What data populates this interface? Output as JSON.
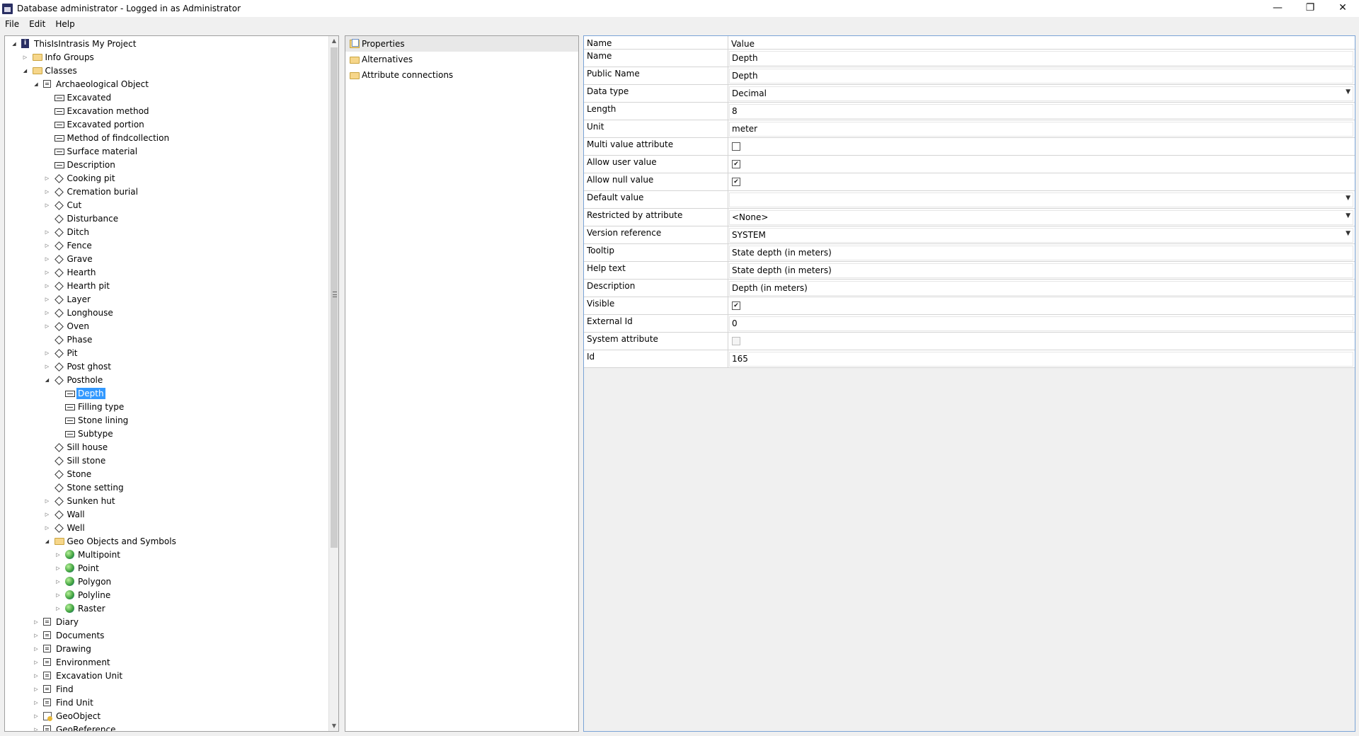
{
  "window": {
    "title": "Database administrator - Logged in as Administrator",
    "controls": {
      "minimize": "—",
      "maximize": "❐",
      "close": "✕"
    }
  },
  "menu": [
    "File",
    "Edit",
    "Help"
  ],
  "tree": [
    {
      "label": "ThisIsIntrasis My Project",
      "depth": 0,
      "icon": "info",
      "expander": "open"
    },
    {
      "label": "Info Groups",
      "depth": 1,
      "icon": "folder",
      "expander": "closed"
    },
    {
      "label": "Classes",
      "depth": 1,
      "icon": "folder",
      "expander": "open"
    },
    {
      "label": "Archaeological Object",
      "depth": 2,
      "icon": "class",
      "expander": "open"
    },
    {
      "label": "Excavated",
      "depth": 3,
      "icon": "attribute",
      "expander": "none"
    },
    {
      "label": "Excavation method",
      "depth": 3,
      "icon": "attribute",
      "expander": "none"
    },
    {
      "label": "Excavated portion",
      "depth": 3,
      "icon": "attribute",
      "expander": "none"
    },
    {
      "label": "Method of findcollection",
      "depth": 3,
      "icon": "attribute",
      "expander": "none"
    },
    {
      "label": "Surface material",
      "depth": 3,
      "icon": "attribute",
      "expander": "none"
    },
    {
      "label": "Description",
      "depth": 3,
      "icon": "attribute",
      "expander": "none"
    },
    {
      "label": "Cooking pit",
      "depth": 3,
      "icon": "subclass",
      "expander": "closed"
    },
    {
      "label": "Cremation burial",
      "depth": 3,
      "icon": "subclass",
      "expander": "closed"
    },
    {
      "label": "Cut",
      "depth": 3,
      "icon": "subclass",
      "expander": "closed"
    },
    {
      "label": "Disturbance",
      "depth": 3,
      "icon": "subclass",
      "expander": "none"
    },
    {
      "label": "Ditch",
      "depth": 3,
      "icon": "subclass",
      "expander": "closed"
    },
    {
      "label": "Fence",
      "depth": 3,
      "icon": "subclass",
      "expander": "closed"
    },
    {
      "label": "Grave",
      "depth": 3,
      "icon": "subclass",
      "expander": "closed"
    },
    {
      "label": "Hearth",
      "depth": 3,
      "icon": "subclass",
      "expander": "closed"
    },
    {
      "label": "Hearth pit",
      "depth": 3,
      "icon": "subclass",
      "expander": "closed"
    },
    {
      "label": "Layer",
      "depth": 3,
      "icon": "subclass",
      "expander": "closed"
    },
    {
      "label": "Longhouse",
      "depth": 3,
      "icon": "subclass",
      "expander": "closed"
    },
    {
      "label": "Oven",
      "depth": 3,
      "icon": "subclass",
      "expander": "closed"
    },
    {
      "label": "Phase",
      "depth": 3,
      "icon": "subclass",
      "expander": "none"
    },
    {
      "label": "Pit",
      "depth": 3,
      "icon": "subclass",
      "expander": "closed"
    },
    {
      "label": "Post ghost",
      "depth": 3,
      "icon": "subclass",
      "expander": "closed"
    },
    {
      "label": "Posthole",
      "depth": 3,
      "icon": "subclass",
      "expander": "open"
    },
    {
      "label": "Depth",
      "depth": 4,
      "icon": "attribute",
      "expander": "none",
      "selected": true
    },
    {
      "label": "Filling type",
      "depth": 4,
      "icon": "attribute",
      "expander": "none"
    },
    {
      "label": "Stone lining",
      "depth": 4,
      "icon": "attribute",
      "expander": "none"
    },
    {
      "label": "Subtype",
      "depth": 4,
      "icon": "attribute",
      "expander": "none"
    },
    {
      "label": "Sill house",
      "depth": 3,
      "icon": "subclass",
      "expander": "none"
    },
    {
      "label": "Sill stone",
      "depth": 3,
      "icon": "subclass",
      "expander": "none"
    },
    {
      "label": "Stone",
      "depth": 3,
      "icon": "subclass",
      "expander": "none"
    },
    {
      "label": "Stone setting",
      "depth": 3,
      "icon": "subclass",
      "expander": "none"
    },
    {
      "label": "Sunken hut",
      "depth": 3,
      "icon": "subclass",
      "expander": "closed"
    },
    {
      "label": "Wall",
      "depth": 3,
      "icon": "subclass",
      "expander": "closed"
    },
    {
      "label": "Well",
      "depth": 3,
      "icon": "subclass",
      "expander": "closed"
    },
    {
      "label": "Geo Objects and Symbols",
      "depth": 3,
      "icon": "folder",
      "expander": "open"
    },
    {
      "label": "Multipoint",
      "depth": 4,
      "icon": "globe",
      "expander": "closed"
    },
    {
      "label": "Point",
      "depth": 4,
      "icon": "globe",
      "expander": "closed"
    },
    {
      "label": "Polygon",
      "depth": 4,
      "icon": "globe",
      "expander": "closed"
    },
    {
      "label": "Polyline",
      "depth": 4,
      "icon": "globe",
      "expander": "closed"
    },
    {
      "label": "Raster",
      "depth": 4,
      "icon": "globe",
      "expander": "closed"
    },
    {
      "label": "Diary",
      "depth": 2,
      "icon": "class",
      "expander": "closed"
    },
    {
      "label": "Documents",
      "depth": 2,
      "icon": "class",
      "expander": "closed"
    },
    {
      "label": "Drawing",
      "depth": 2,
      "icon": "class",
      "expander": "closed"
    },
    {
      "label": "Environment",
      "depth": 2,
      "icon": "class",
      "expander": "closed"
    },
    {
      "label": "Excavation Unit",
      "depth": 2,
      "icon": "class",
      "expander": "closed"
    },
    {
      "label": "Find",
      "depth": 2,
      "icon": "class",
      "expander": "closed"
    },
    {
      "label": "Find Unit",
      "depth": 2,
      "icon": "class",
      "expander": "closed"
    },
    {
      "label": "GeoObject",
      "depth": 2,
      "icon": "geoobject",
      "expander": "closed"
    },
    {
      "label": "GeoReference",
      "depth": 2,
      "icon": "class",
      "expander": "closed"
    }
  ],
  "middle_list": [
    {
      "label": "Properties",
      "icon": "properties",
      "selected": true
    },
    {
      "label": "Alternatives",
      "icon": "folder"
    },
    {
      "label": "Attribute connections",
      "icon": "folder"
    }
  ],
  "property_grid": {
    "headers": {
      "name": "Name",
      "value": "Value"
    },
    "rows": [
      {
        "name": "Name",
        "type": "text",
        "value": "Depth"
      },
      {
        "name": "Public Name",
        "type": "text",
        "value": "Depth"
      },
      {
        "name": "Data type",
        "type": "dropdown",
        "value": "Decimal"
      },
      {
        "name": "Length",
        "type": "text",
        "value": "8"
      },
      {
        "name": "Unit",
        "type": "text",
        "value": "meter"
      },
      {
        "name": "Multi value attribute",
        "type": "checkbox",
        "checked": false
      },
      {
        "name": "Allow user value",
        "type": "checkbox",
        "checked": true
      },
      {
        "name": "Allow null value",
        "type": "checkbox",
        "checked": true
      },
      {
        "name": "Default value",
        "type": "dropdown",
        "value": ""
      },
      {
        "name": "Restricted by attribute",
        "type": "dropdown",
        "value": "<None>"
      },
      {
        "name": "Version reference",
        "type": "dropdown",
        "value": "SYSTEM"
      },
      {
        "name": "Tooltip",
        "type": "text",
        "value": "State depth (in meters)"
      },
      {
        "name": "Help text",
        "type": "text",
        "value": "State depth (in meters)"
      },
      {
        "name": "Description",
        "type": "text",
        "value": "Depth (in meters)"
      },
      {
        "name": "Visible",
        "type": "checkbox",
        "checked": true
      },
      {
        "name": "External Id",
        "type": "text",
        "value": "0"
      },
      {
        "name": "System attribute",
        "type": "checkbox",
        "checked": false,
        "disabled": true
      },
      {
        "name": "Id",
        "type": "text",
        "value": "165"
      }
    ]
  }
}
